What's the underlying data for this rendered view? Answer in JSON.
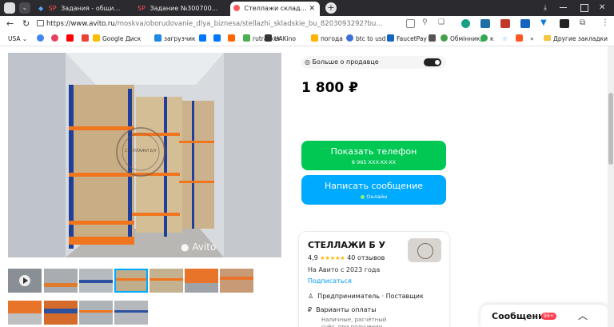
{
  "browser": {
    "tabs": [
      {
        "label": "Задания - общий список",
        "active": false
      },
      {
        "label": "Задание №3007004 - про",
        "active": false
      },
      {
        "label": "Стеллажи складские б/у",
        "active": true
      }
    ],
    "url_domain": "https://www.avito.ru",
    "url_path": "/moskva/oborudovanie_dlya_biznesa/stellazhi_skladskie_bu_8203093292?bu..."
  },
  "bookmarks": [
    {
      "label": "USA",
      "color": "#888888"
    },
    {
      "label": "",
      "color": "#4285f4"
    },
    {
      "label": "",
      "color": "#e4405f"
    },
    {
      "label": "",
      "color": "#ff0000"
    },
    {
      "label": "",
      "color": "#ea4335"
    },
    {
      "label": "Google Диск",
      "color": "#fbbc04"
    },
    {
      "label": "загрузчик",
      "color": "#1e88e5"
    },
    {
      "label": "",
      "color": "#0077ff"
    },
    {
      "label": "",
      "color": "#0077ff"
    },
    {
      "label": "",
      "color": "#ff6600"
    },
    {
      "label": "rutracker",
      "color": "#4caf50"
    },
    {
      "label": "UAKino",
      "color": "#333333"
    },
    {
      "label": "погода",
      "color": "#ffb300"
    },
    {
      "label": "btc to usd",
      "color": "#3f6fd8"
    },
    {
      "label": "FaucetPay",
      "color": "#1565c0"
    },
    {
      "label": "",
      "color": "#555555"
    },
    {
      "label": "Обмінник",
      "color": "#43a047"
    },
    {
      "label": "к",
      "color": "#34a853"
    },
    {
      "label": "",
      "color": "#03a9f4"
    },
    {
      "label": "",
      "color": "#ff5722"
    }
  ],
  "other_bookmarks": "Другие закладки",
  "listing": {
    "watermark": "Avito",
    "stamp_text": "СТЕЛЛАЖИ Б/У",
    "more_about_seller": "Больше о продавце",
    "price": "1 800 ₽",
    "show_phone": "Показать телефон",
    "phone_masked": "8 965 XXX-XX-XX",
    "write_message": "Написать сообщение",
    "online": "Онлайн",
    "green": "#00c853",
    "blue": "#00aaff"
  },
  "seller": {
    "name": "СТЕЛЛАЖИ Б У",
    "rating": "4,9",
    "stars": "★★★★★",
    "reviews": "40 отзывов",
    "since": "На Авито с 2023 года",
    "subscribe": "Подписаться",
    "type": "Предприниматель · Поставщик",
    "payment_title": "Варианты оплаты",
    "payment_desc": "Наличные, расчётный счёт, при получении"
  },
  "messages": {
    "label": "Сообщения",
    "badge": "99+"
  }
}
